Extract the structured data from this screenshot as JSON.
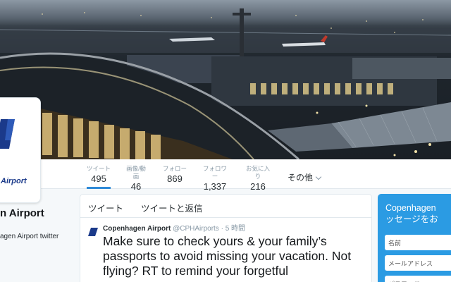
{
  "profile": {
    "logo_text": "Airport",
    "name": "n Airport",
    "description": "agen Airport twitter"
  },
  "stats": [
    {
      "label": "ツイート",
      "value": "495"
    },
    {
      "label": "画像/動画",
      "value": "46"
    },
    {
      "label": "フォロー",
      "value": "869"
    },
    {
      "label": "フォロワー",
      "value": "1,337"
    },
    {
      "label": "お気に入り",
      "value": "216"
    }
  ],
  "more_label": "その他",
  "tabs": {
    "tweets": "ツイート",
    "tweets_replies": "ツイートと返信"
  },
  "tweet": {
    "name": "Copenhagen Airport",
    "handle": "@CPHAirports",
    "separator": "·",
    "time": "5 時間",
    "text": "Make sure to check yours & your family’s passports to avoid missing your vacation. Not flying? RT to remind your forgetful"
  },
  "widget": {
    "title_line1": "Copenhagen",
    "title_line2": "ッセージをお",
    "name_placeholder": "名前",
    "email_placeholder": "メールアドレス",
    "password_placeholder": "パスワード"
  },
  "colors": {
    "accent": "#2b9be3",
    "active_tab_underline": "#2e8ad8",
    "logo_blue": "#1b3a8a"
  }
}
